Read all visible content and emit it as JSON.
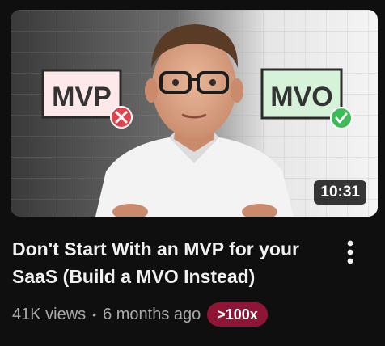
{
  "video": {
    "title": "Don't Start With an MVP for your SaaS (Build a MVO Instead)",
    "duration": "10:31",
    "views": "41K views",
    "separator": "•",
    "age": "6 months ago",
    "outlier_badge": ">100x",
    "thumbnail": {
      "left_label": "MVP",
      "right_label": "MVO",
      "left_status_icon": "x-circle-icon",
      "right_status_icon": "check-circle-icon"
    }
  },
  "menu": {
    "icon": "more-vertical-icon"
  },
  "colors": {
    "background": "#0f0f0f",
    "title_text": "#f1f1f1",
    "meta_text": "#aaaaaa",
    "badge_bg": "#8e1535",
    "mvp_box": "#fde9ea",
    "mvo_box": "#d6f2d8",
    "red_status": "#e2424b",
    "green_status": "#3dbb55"
  }
}
